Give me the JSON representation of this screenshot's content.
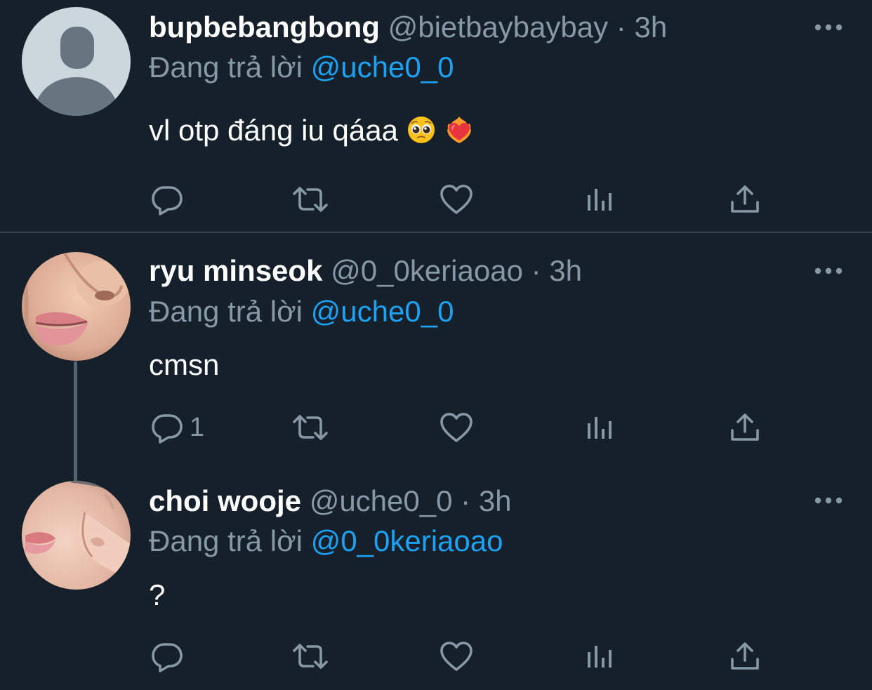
{
  "colors": {
    "background": "#15202b",
    "primary_text": "#ffffff",
    "secondary_text": "#8899a6",
    "accent": "#1da1f2",
    "divider": "#38444d",
    "thread_line": "#536471"
  },
  "tweets": [
    {
      "display_name": "bupbebangbong",
      "handle": "@bietbaybaybay",
      "separator": "·",
      "time": "3h",
      "reply_prefix": "Đang trả lời",
      "reply_mention": "@uche0_0",
      "text": "vl otp đáng iu qáaa",
      "emojis": [
        "pleading-face-emoji",
        "heart-on-fire-emoji"
      ],
      "avatar": "default-avatar",
      "reply_count": ""
    },
    {
      "display_name": "ryu minseok",
      "handle": "@0_0keriaoao",
      "separator": "·",
      "time": "3h",
      "reply_prefix": "Đang trả lời",
      "reply_mention": "@uche0_0",
      "text": "cmsn",
      "avatar": "photo-avatar",
      "reply_count": "1"
    },
    {
      "display_name": "choi wooje",
      "handle": "@uche0_0",
      "separator": "·",
      "time": "3h",
      "reply_prefix": "Đang trả lời",
      "reply_mention": "@0_0keriaoao",
      "text": "?",
      "avatar": "photo-avatar",
      "reply_count": ""
    }
  ],
  "action_icons": [
    "reply-icon",
    "retweet-icon",
    "like-icon",
    "views-icon",
    "share-icon"
  ]
}
